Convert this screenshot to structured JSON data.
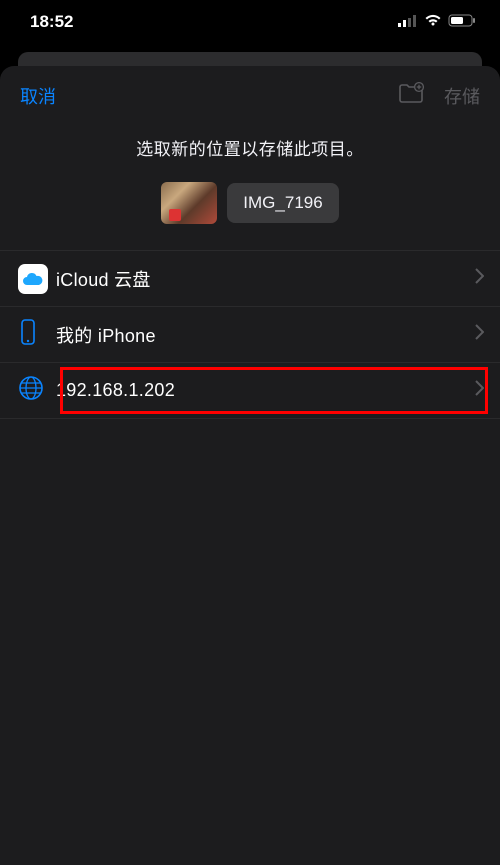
{
  "status": {
    "time": "18:52"
  },
  "sheet": {
    "cancel": "取消",
    "save": "存储",
    "instruction": "选取新的位置以存储此项目。",
    "filename": "IMG_7196"
  },
  "locations": [
    {
      "id": "icloud",
      "label": "iCloud 云盘",
      "icon": "icloud"
    },
    {
      "id": "myiphone",
      "label": "我的 iPhone",
      "icon": "iphone"
    },
    {
      "id": "server",
      "label": "192.168.1.202",
      "icon": "globe",
      "highlighted": true
    }
  ]
}
